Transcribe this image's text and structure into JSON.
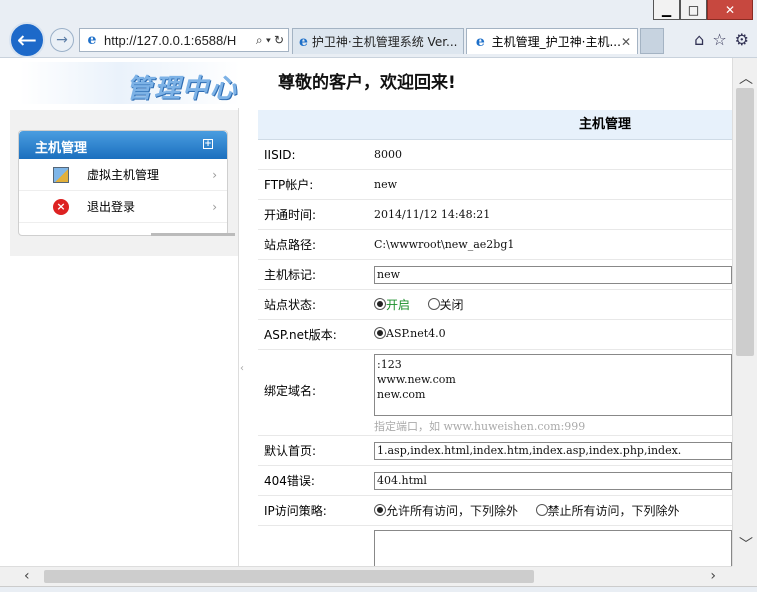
{
  "browser": {
    "address": "http://127.0.0.1:6588/H",
    "tabs": [
      {
        "title": "护卫神·主机管理系统 Ver..."
      },
      {
        "title": "主机管理_护卫神·主机..."
      }
    ]
  },
  "header": {
    "logo_text": "管理中心",
    "welcome": "尊敬的客户，欢迎回来!"
  },
  "sidebar": {
    "title": "主机管理",
    "items": [
      {
        "label": "虚拟主机管理"
      },
      {
        "label": "退出登录"
      }
    ]
  },
  "form": {
    "title": "主机管理",
    "rows": {
      "iisid": {
        "label": "IISID:",
        "value": "8000"
      },
      "ftp": {
        "label": "FTP帐户:",
        "value": "new"
      },
      "opened": {
        "label": "开通时间:",
        "value": "2014/11/12 14:48:21"
      },
      "path": {
        "label": "站点路径:",
        "value": "C:\\wwwroot\\new_ae2bg1"
      },
      "mark": {
        "label": "主机标记:",
        "value": "new"
      },
      "status": {
        "label": "站点状态:",
        "on": "开启",
        "off": "关闭"
      },
      "aspnet": {
        "label": "ASP.net版本:",
        "option": "ASP.net4.0"
      },
      "domains": {
        "label": "绑定域名:",
        "value": ":123\nwww.new.com\nnew.com",
        "hint": "指定端口，如 www.huweishen.com:999"
      },
      "default_page": {
        "label": "默认首页:",
        "value": "1.asp,index.html,index.htm,index.asp,index.php,index."
      },
      "error404": {
        "label": "404错误:",
        "value": "404.html"
      },
      "ip_policy": {
        "label": "IP访问策略:",
        "allow": "允许所有访问，下列除外",
        "deny": "禁止所有访问，下列除外"
      }
    }
  }
}
